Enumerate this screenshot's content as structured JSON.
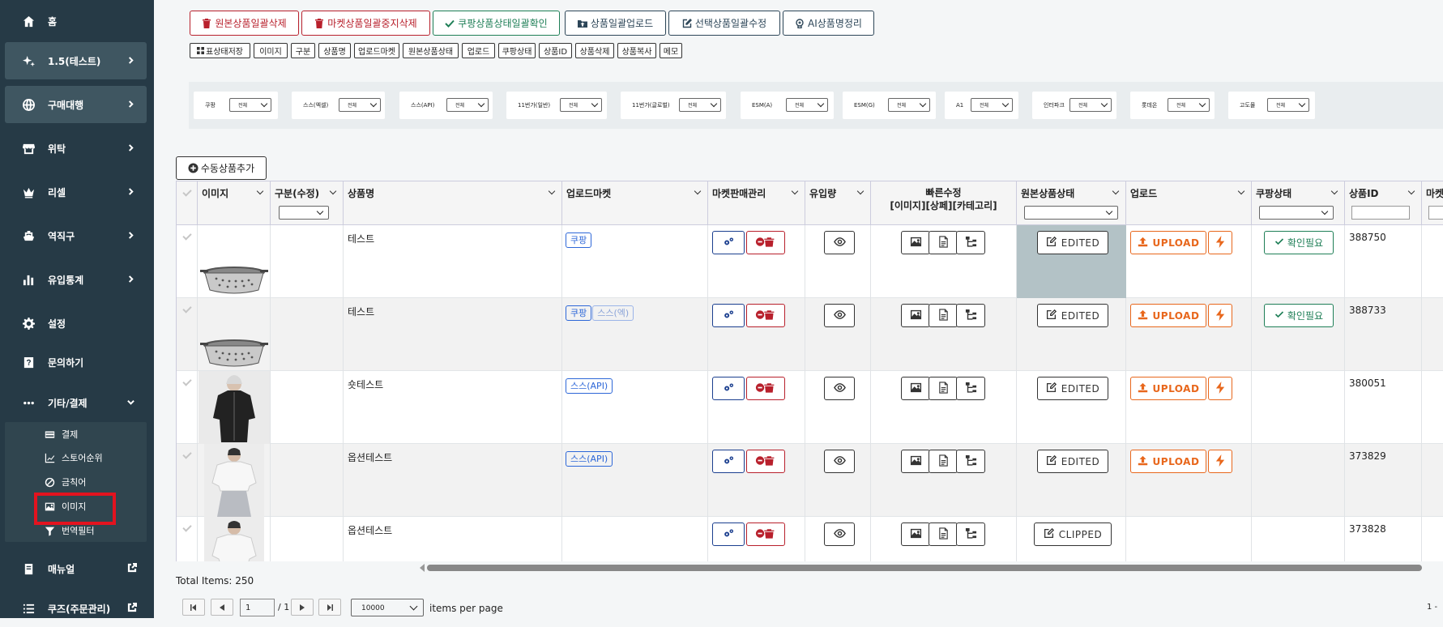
{
  "sidebar": {
    "items": [
      {
        "label": "홈",
        "icon": "home-icon"
      },
      {
        "label": "1.5(테스트)",
        "icon": "sparkle-icon"
      },
      {
        "label": "구매대행",
        "icon": "globe-icon"
      },
      {
        "label": "위탁",
        "icon": "store-icon"
      },
      {
        "label": "리셀",
        "icon": "crown-icon"
      },
      {
        "label": "역직구",
        "icon": "ship-icon"
      },
      {
        "label": "유입통계",
        "icon": "bar-chart-icon"
      },
      {
        "label": "설정",
        "icon": "gear-icon"
      },
      {
        "label": "문의하기",
        "icon": "question-icon"
      },
      {
        "label": "기타/결제",
        "icon": "ellipsis-icon"
      },
      {
        "label": "매뉴얼",
        "icon": "book-icon"
      },
      {
        "label": "쿠즈(주문관리)",
        "icon": "list-icon"
      }
    ],
    "submenu": [
      {
        "label": "결제",
        "icon": "credit-card-icon"
      },
      {
        "label": "스토어순위",
        "icon": "line-chart-icon"
      },
      {
        "label": "금칙어",
        "icon": "ban-icon"
      },
      {
        "label": "이미지",
        "icon": "image-icon"
      },
      {
        "label": "번역필터",
        "icon": "filter-icon"
      }
    ]
  },
  "toolbar": {
    "buttons": [
      "원본상품일괄삭제",
      "마켓상품일괄중지삭제",
      "쿠팡상품상태일괄확인",
      "상품일괄업로드",
      "선택상품일괄수정",
      "AI상품명정리"
    ]
  },
  "column_toggles": [
    "표상태저장",
    "이미지",
    "구분",
    "상품명",
    "업로드마켓",
    "원본상품상태",
    "업로드",
    "쿠팡상태",
    "상품ID",
    "상품삭제",
    "상품복사",
    "메모"
  ],
  "filters": [
    {
      "label": "쿠팡",
      "value": "전체"
    },
    {
      "label": "스스(엑셀)",
      "value": "전체"
    },
    {
      "label": "스스(API)",
      "value": "전체"
    },
    {
      "label": "11번가(일반)",
      "value": "전체"
    },
    {
      "label": "11번가(글로벌)",
      "value": "전체"
    },
    {
      "label": "ESM(A)",
      "value": "전체"
    },
    {
      "label": "ESM(G)",
      "value": "전체"
    },
    {
      "label": "A1",
      "value": "전체"
    },
    {
      "label": "인터파크",
      "value": "전체"
    },
    {
      "label": "롯데온",
      "value": "전체"
    },
    {
      "label": "고도몰",
      "value": "전체"
    }
  ],
  "add_product_label": "수동상품추가",
  "table": {
    "headers": {
      "image": "이미지",
      "type": "구분(수정)",
      "name": "상품명",
      "market": "업로드마켓",
      "manage": "마켓판매관리",
      "inflow": "유입량",
      "quick_edit": "빠른수정",
      "quick_edit_sub": "[이미지][상페][카테고리]",
      "source_status": "원본상품상태",
      "upload": "업로드",
      "coupang_status": "쿠팡상태",
      "product_id": "상품ID",
      "market_cut": "마켓"
    },
    "rows": [
      {
        "name": "테스트",
        "markets": [
          "쿠팡"
        ],
        "status": "EDITED",
        "upload": "UPLOAD",
        "coupang": "확인필요",
        "id": "388750",
        "image": "pot-image"
      },
      {
        "name": "테스트",
        "markets": [
          "쿠팡",
          "스스(엑)"
        ],
        "status": "EDITED",
        "upload": "UPLOAD",
        "coupang": "확인필요",
        "id": "388733",
        "image": "pot-image"
      },
      {
        "name": "숏테스트",
        "markets": [
          "스스(API)"
        ],
        "status": "EDITED",
        "upload": "UPLOAD",
        "coupang": "",
        "id": "380051",
        "image": "jacket-image"
      },
      {
        "name": "옵션테스트",
        "markets": [
          "스스(API)"
        ],
        "status": "EDITED",
        "upload": "UPLOAD",
        "coupang": "",
        "id": "373829",
        "image": "white-top-image"
      },
      {
        "name": "옵션테스트",
        "markets": [],
        "status": "CLIPPED",
        "upload": "",
        "coupang": "",
        "id": "373828",
        "image": "white-top-image"
      }
    ]
  },
  "footer": {
    "total_items": "Total Items: 250",
    "page": "1",
    "page_of": "/ 1",
    "page_size": "10000",
    "per_page_label": "items per page",
    "range": "1 -"
  }
}
